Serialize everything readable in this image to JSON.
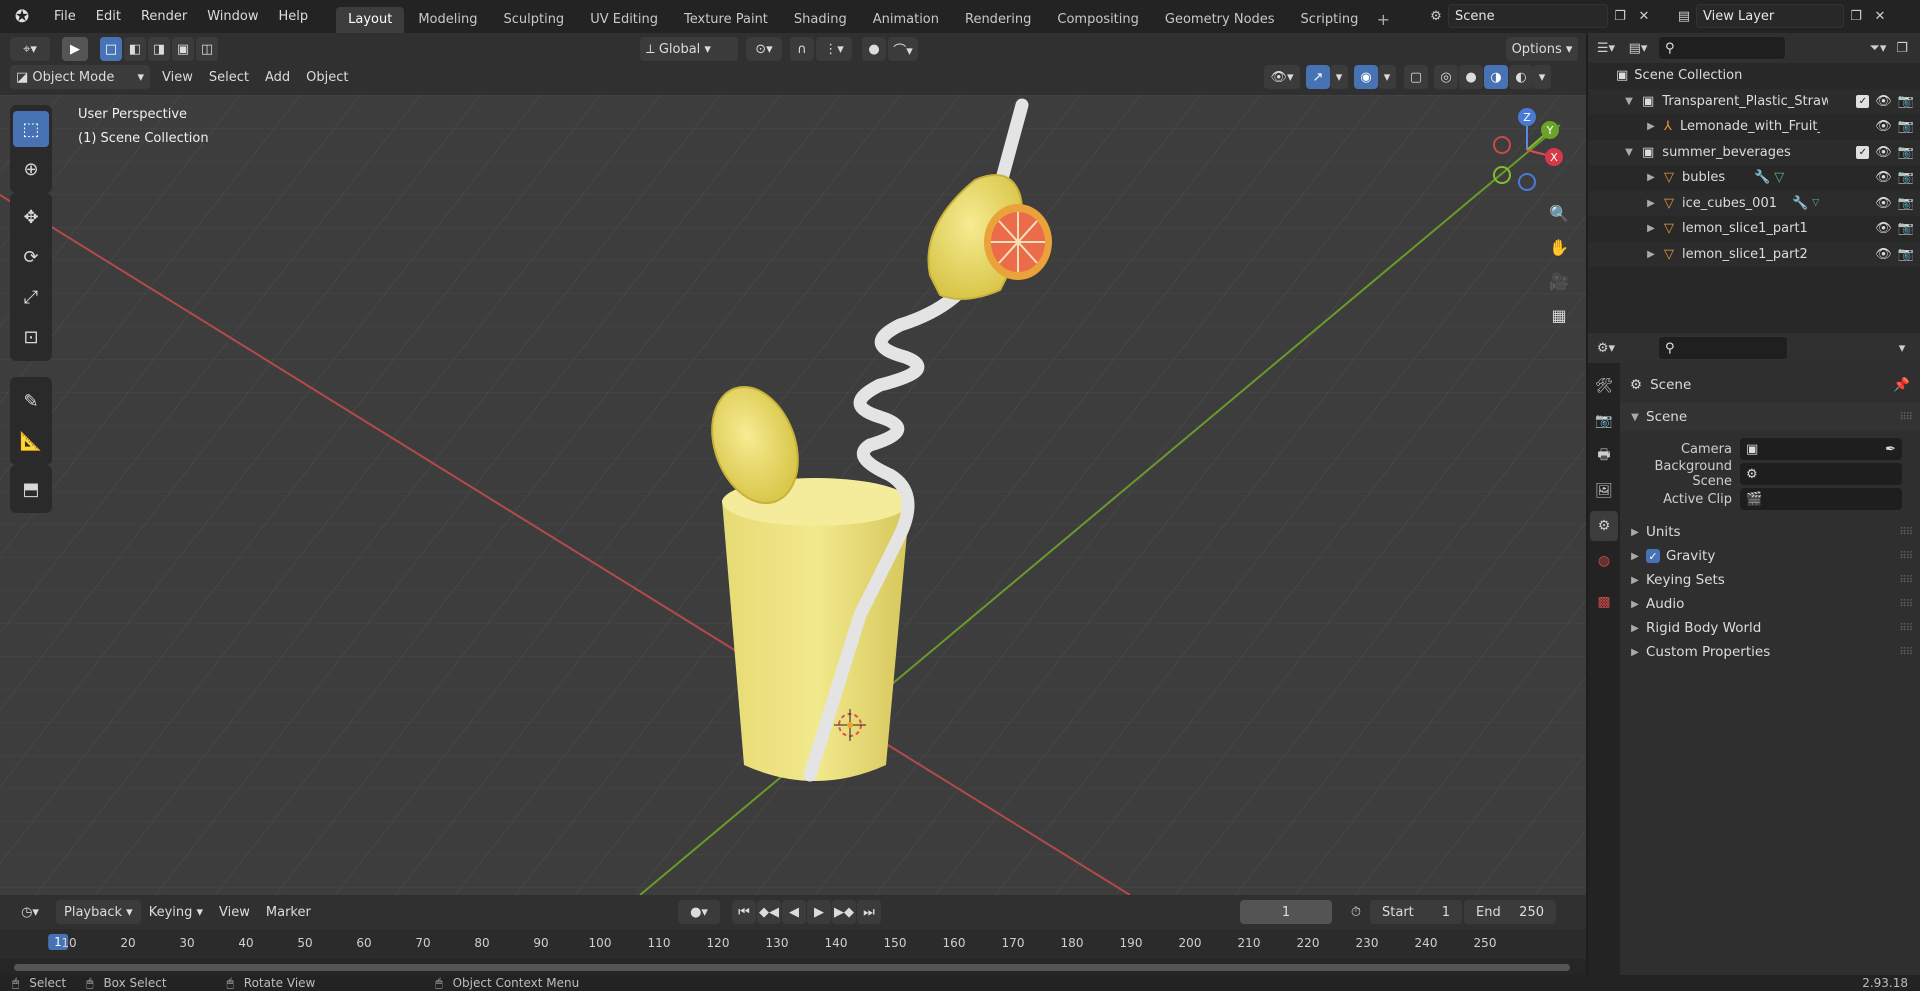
{
  "topbar": {
    "menus": [
      "File",
      "Edit",
      "Render",
      "Window",
      "Help"
    ],
    "tabs": [
      "Layout",
      "Modeling",
      "Sculpting",
      "UV Editing",
      "Texture Paint",
      "Shading",
      "Animation",
      "Rendering",
      "Compositing",
      "Geometry Nodes",
      "Scripting"
    ],
    "active_tab": "Layout",
    "scene": "Scene",
    "view_layer": "View Layer"
  },
  "viewport_header": {
    "transform_orientation": "Global",
    "options_label": "Options",
    "mode": "Object Mode",
    "menus": [
      "View",
      "Select",
      "Add",
      "Object"
    ]
  },
  "viewport": {
    "perspective": "User Perspective",
    "collection": "(1) Scene Collection",
    "gizmo": {
      "x": "X",
      "y": "Y",
      "z": "Z"
    }
  },
  "timeline": {
    "menus": [
      "Playback",
      "Keying",
      "View",
      "Marker"
    ],
    "current_frame": "1",
    "start_label": "Start",
    "start": "1",
    "end_label": "End",
    "end": "250",
    "ticks": [
      "10",
      "20",
      "30",
      "40",
      "50",
      "60",
      "70",
      "80",
      "90",
      "100",
      "110",
      "120",
      "130",
      "140",
      "150",
      "160",
      "170",
      "180",
      "190",
      "200",
      "210",
      "220",
      "230",
      "240",
      "250"
    ],
    "playhead": "1"
  },
  "status": {
    "select": "Select",
    "box_select": "Box Select",
    "rotate_view": "Rotate View",
    "context_menu": "Object Context Menu",
    "version": "2.93.18"
  },
  "outliner": {
    "root": "Scene Collection",
    "items": [
      {
        "label": "Transparent_Plastic_Straws_w",
        "type": "collection"
      },
      {
        "label": "Lemonade_with_Fruit_Pl",
        "type": "armature"
      },
      {
        "label": "summer_beverages",
        "type": "collection"
      },
      {
        "label": "bubles",
        "type": "mesh"
      },
      {
        "label": "ice_cubes_001",
        "type": "mesh"
      },
      {
        "label": "lemon_slice1_part1",
        "type": "mesh"
      },
      {
        "label": "lemon_slice1_part2",
        "type": "mesh"
      }
    ]
  },
  "properties": {
    "context": "Scene",
    "panel": "Scene",
    "camera_label": "Camera",
    "background_scene_label": "Background Scene",
    "active_clip_label": "Active Clip",
    "sections": [
      "Units",
      "Gravity",
      "Keying Sets",
      "Audio",
      "Rigid Body World",
      "Custom Properties"
    ]
  }
}
